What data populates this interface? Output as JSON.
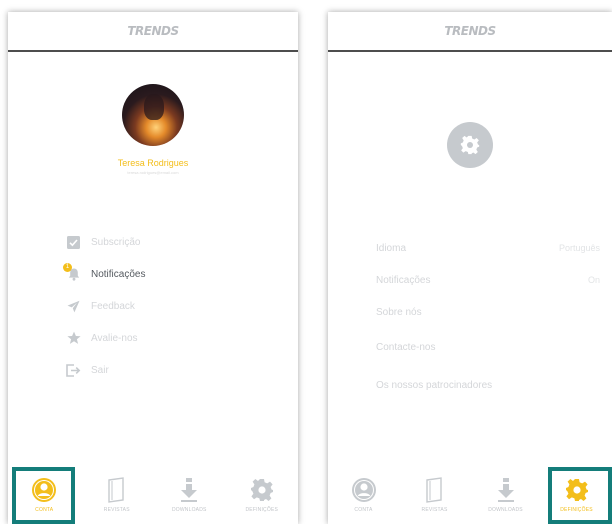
{
  "colors": {
    "accent": "#f3be1b",
    "highlight": "#147d7a",
    "muted": "#d4d6d9",
    "icon": "#c6cace"
  },
  "left_screen": {
    "header": {
      "logo": "TRENDS"
    },
    "profile": {
      "name": "Teresa Rodrigues",
      "email": "teresa.rodrigues@email.com"
    },
    "menu": [
      {
        "label": "Subscrição",
        "icon": "checkbox-icon"
      },
      {
        "label": "Notificações",
        "icon": "bell-icon",
        "badge": "1"
      },
      {
        "label": "Feedback",
        "icon": "send-icon"
      },
      {
        "label": "Avalie-nos",
        "icon": "star-icon"
      },
      {
        "label": "Sair",
        "icon": "logout-icon"
      }
    ],
    "tabs": [
      {
        "label": "CONTA",
        "icon": "user-icon",
        "active": true
      },
      {
        "label": "REVISTAS",
        "icon": "magazine-icon"
      },
      {
        "label": "DOWNLOADS",
        "icon": "download-icon"
      },
      {
        "label": "DEFINIÇÕES",
        "icon": "gear-icon"
      }
    ]
  },
  "right_screen": {
    "header": {
      "logo": "TRENDS"
    },
    "settings": [
      {
        "label": "Idioma",
        "value": "Português"
      },
      {
        "label": "Notificações",
        "value": "On"
      },
      {
        "label": "Sobre nós"
      },
      {
        "label": "Contacte-nos"
      },
      {
        "label": "Os nossos patrocinadores"
      }
    ],
    "tabs": [
      {
        "label": "CONTA",
        "icon": "user-icon"
      },
      {
        "label": "REVISTAS",
        "icon": "magazine-icon"
      },
      {
        "label": "DOWNLOADS",
        "icon": "download-icon"
      },
      {
        "label": "DEFINIÇÕES",
        "icon": "gear-icon",
        "active": true
      }
    ]
  }
}
